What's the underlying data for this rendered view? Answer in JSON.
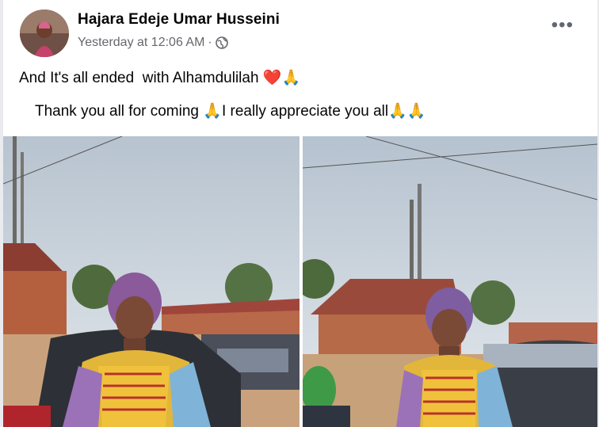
{
  "post": {
    "author": "Hajara Edeje Umar Husseini",
    "timestamp": "Yesterday at 12:06 AM",
    "separator": "·",
    "privacy_icon": "globe-icon",
    "more_label": "•••",
    "text_line1": "And It's all ended  with Alhamdulilah ",
    "text_line1_emojis": [
      "❤️",
      "🙏"
    ],
    "text_line2_a": "Thank you all for coming ",
    "text_line2_b": "I really appreciate you all",
    "text_line2_emojis": [
      "🙏",
      "🙏🙏"
    ]
  },
  "photos": [
    {
      "name": "photo-left"
    },
    {
      "name": "photo-right"
    }
  ],
  "colors": {
    "author": "#050505",
    "meta": "#65676b",
    "heart": "#e0242b",
    "background": "#ffffff"
  }
}
